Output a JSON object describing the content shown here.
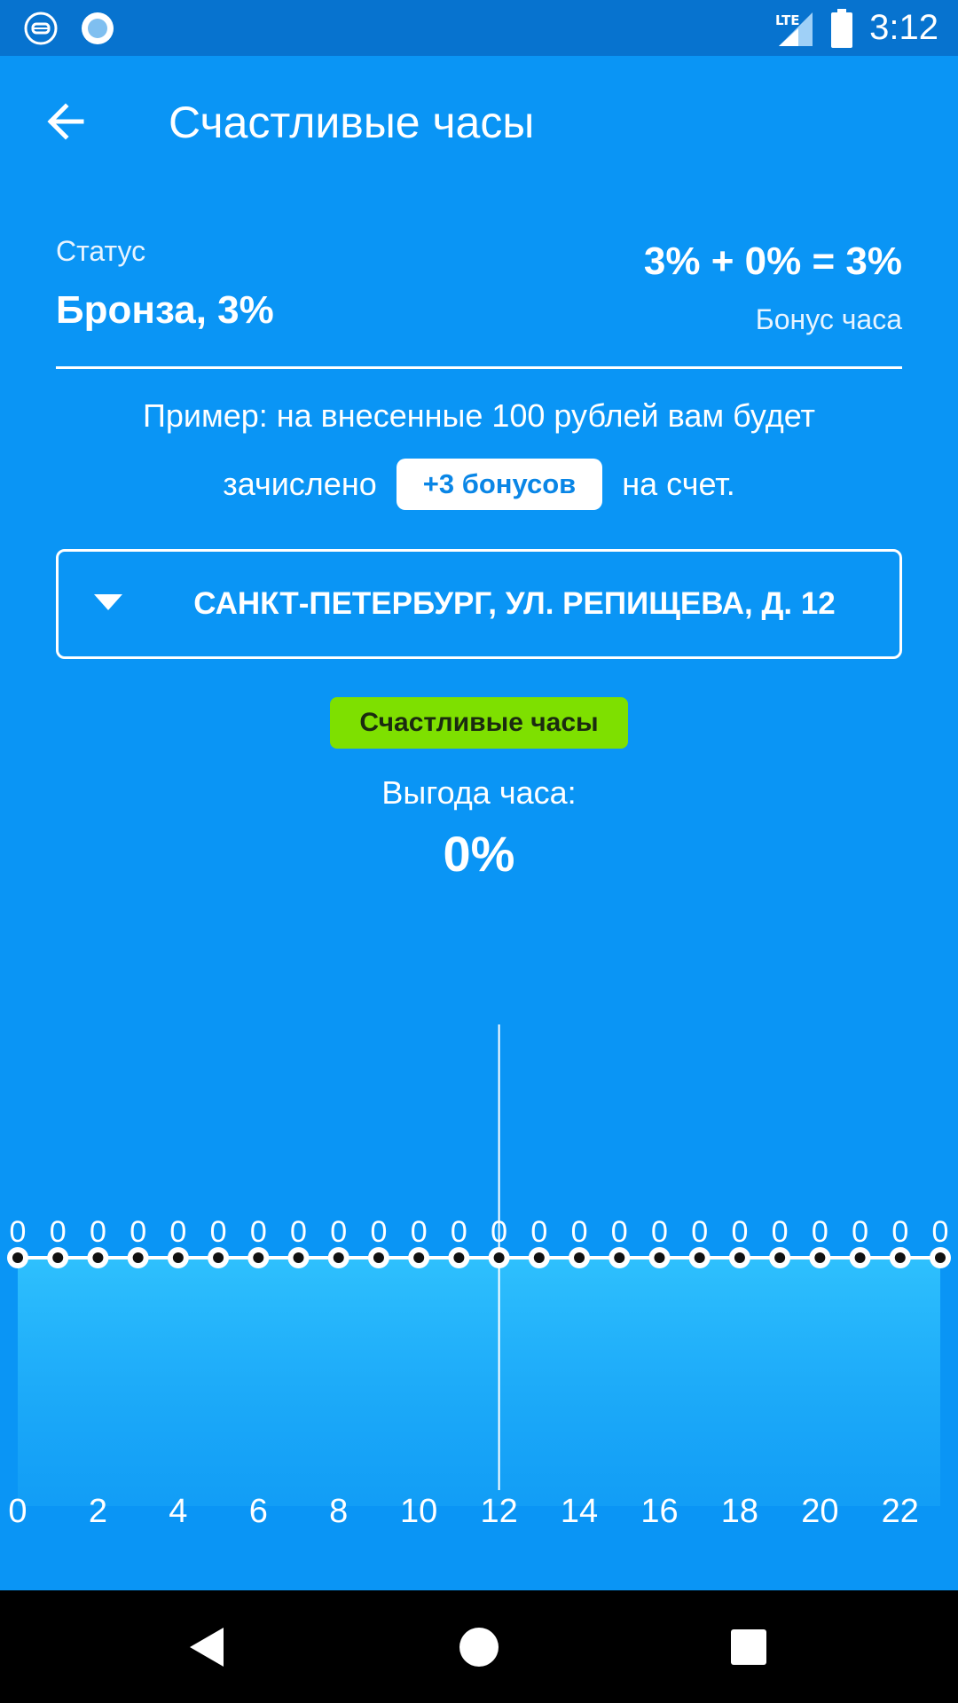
{
  "status_bar": {
    "time": "3:12",
    "network": "LTE"
  },
  "app_bar": {
    "title": "Счастливые часы"
  },
  "status": {
    "label": "Статус",
    "value": "Бронза, 3%",
    "formula": "3% + 0% = 3%",
    "bonus_label": "Бонус часа"
  },
  "example": {
    "line1": "Пример: на внесенные 100 рублей вам будет",
    "before": "зачислено",
    "pill": "+3 бонусов",
    "after": "на счет."
  },
  "address": {
    "value": "САНКТ-ПЕТЕРБУРГ, УЛ. РЕПИЩЕВА, Д. 12"
  },
  "happy_hours_button": "Счастливые часы",
  "benefit": {
    "label": "Выгода часа:",
    "value": "0%"
  },
  "colors": {
    "background": "#0a95f5",
    "status_bar": "#0773cf",
    "happy_button": "#7ee000",
    "pill_text": "#0a86e6"
  },
  "chart_data": {
    "type": "area",
    "x": [
      0,
      1,
      2,
      3,
      4,
      5,
      6,
      7,
      8,
      9,
      10,
      11,
      12,
      13,
      14,
      15,
      16,
      17,
      18,
      19,
      20,
      21,
      22,
      23
    ],
    "values": [
      0,
      0,
      0,
      0,
      0,
      0,
      0,
      0,
      0,
      0,
      0,
      0,
      0,
      0,
      0,
      0,
      0,
      0,
      0,
      0,
      0,
      0,
      0,
      0
    ],
    "tick_labels": [
      "0",
      "2",
      "4",
      "6",
      "8",
      "10",
      "12",
      "14",
      "16",
      "18",
      "20",
      "22"
    ],
    "selected_x": 12,
    "ylim": [
      0,
      1
    ],
    "grid": true
  }
}
